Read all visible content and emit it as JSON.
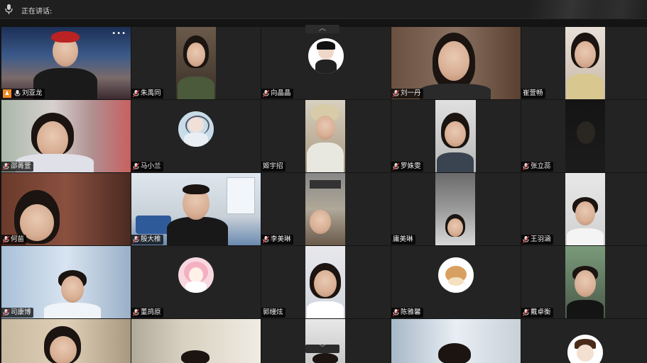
{
  "topbar": {
    "speaking_label": "正在讲话:"
  },
  "scroll": {
    "up_icon": "chevron-up-icon",
    "down_icon": "chevron-down-icon"
  },
  "participants": [
    "刘亚龙",
    "朱禹同",
    "向晶晶",
    "刘一丹",
    "崔萱畅",
    "邵菁萱",
    "马小兰",
    "姬宇招",
    "罗姝雯",
    "张立蕊",
    "何苗",
    "殷大椎",
    "李美琳",
    "庸美琳",
    "王羽涵",
    "司康博",
    "董鸪原",
    "郭缦炫",
    "陈雅馨",
    "戴卓衡"
  ],
  "colors": {
    "host_badge": "#f08a24",
    "background": "#141414",
    "tile": "#232323"
  }
}
